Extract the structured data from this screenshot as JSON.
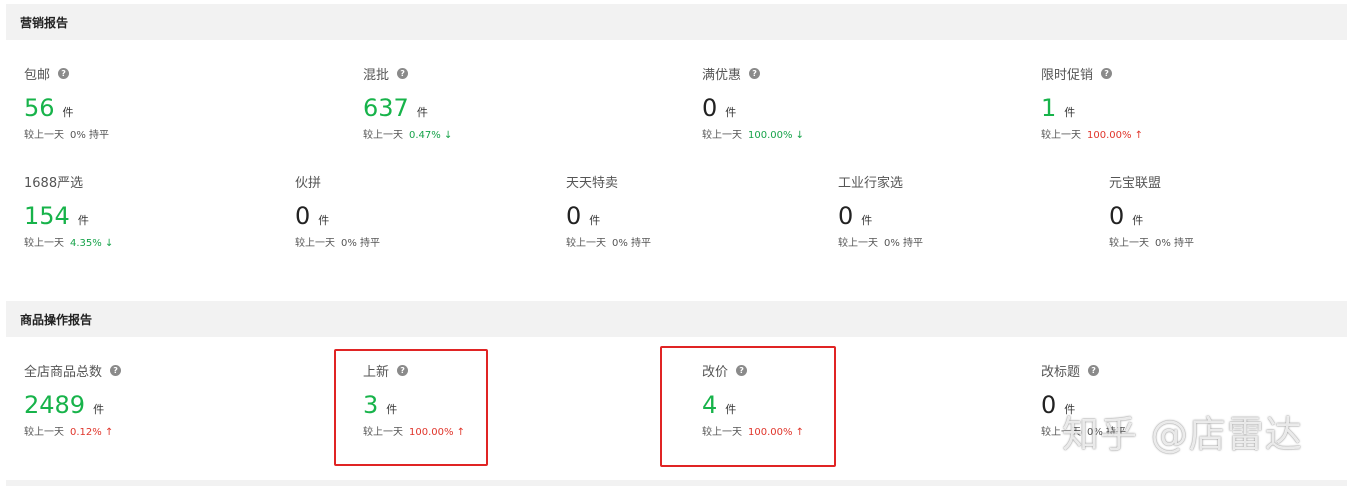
{
  "marketing": {
    "title": "营销报告",
    "compare_prefix": "较上一天",
    "row1": [
      {
        "label": "包邮",
        "help": "?",
        "value": "56",
        "unit": "件",
        "pct": "0% 持平",
        "trend": "neutral"
      },
      {
        "label": "混批",
        "help": "?",
        "value": "637",
        "unit": "件",
        "pct": "0.47% ↓",
        "trend": "down"
      },
      {
        "label": "满优惠",
        "help": "?",
        "value": "0",
        "unit": "件",
        "pct": "100.00% ↓",
        "trend": "down"
      },
      {
        "label": "限时促销",
        "help": "?",
        "value": "1",
        "unit": "件",
        "pct": "100.00% ↑",
        "trend": "up"
      }
    ],
    "row2": [
      {
        "label": "1688严选",
        "value": "154",
        "unit": "件",
        "pct": "4.35% ↓",
        "trend": "down"
      },
      {
        "label": "伙拼",
        "value": "0",
        "unit": "件",
        "pct": "0% 持平",
        "trend": "neutral"
      },
      {
        "label": "天天特卖",
        "value": "0",
        "unit": "件",
        "pct": "0% 持平",
        "trend": "neutral"
      },
      {
        "label": "工业行家选",
        "value": "0",
        "unit": "件",
        "pct": "0% 持平",
        "trend": "neutral"
      },
      {
        "label": "元宝联盟",
        "value": "0",
        "unit": "件",
        "pct": "0% 持平",
        "trend": "neutral"
      }
    ]
  },
  "product_ops": {
    "title": "商品操作报告",
    "compare_prefix": "较上一天",
    "items": [
      {
        "label": "全店商品总数",
        "help": "?",
        "value": "2489",
        "unit": "件",
        "pct": "0.12% ↑",
        "trend": "up"
      },
      {
        "label": "上新",
        "help": "?",
        "value": "3",
        "unit": "件",
        "pct": "100.00% ↑",
        "trend": "up"
      },
      {
        "label": "改价",
        "help": "?",
        "value": "4",
        "unit": "件",
        "pct": "100.00% ↑",
        "trend": "up"
      },
      {
        "label": "改标题",
        "help": "?",
        "value": "0",
        "unit": "件",
        "pct": "0% 持平",
        "trend": "neutral"
      }
    ]
  },
  "watermark": "知乎 @店雷达",
  "colors": {
    "green": "#17b34a",
    "up": "#e0352b",
    "down": "#17a34a",
    "highlight": "#e02424",
    "header_bg": "#f2f2f2"
  }
}
